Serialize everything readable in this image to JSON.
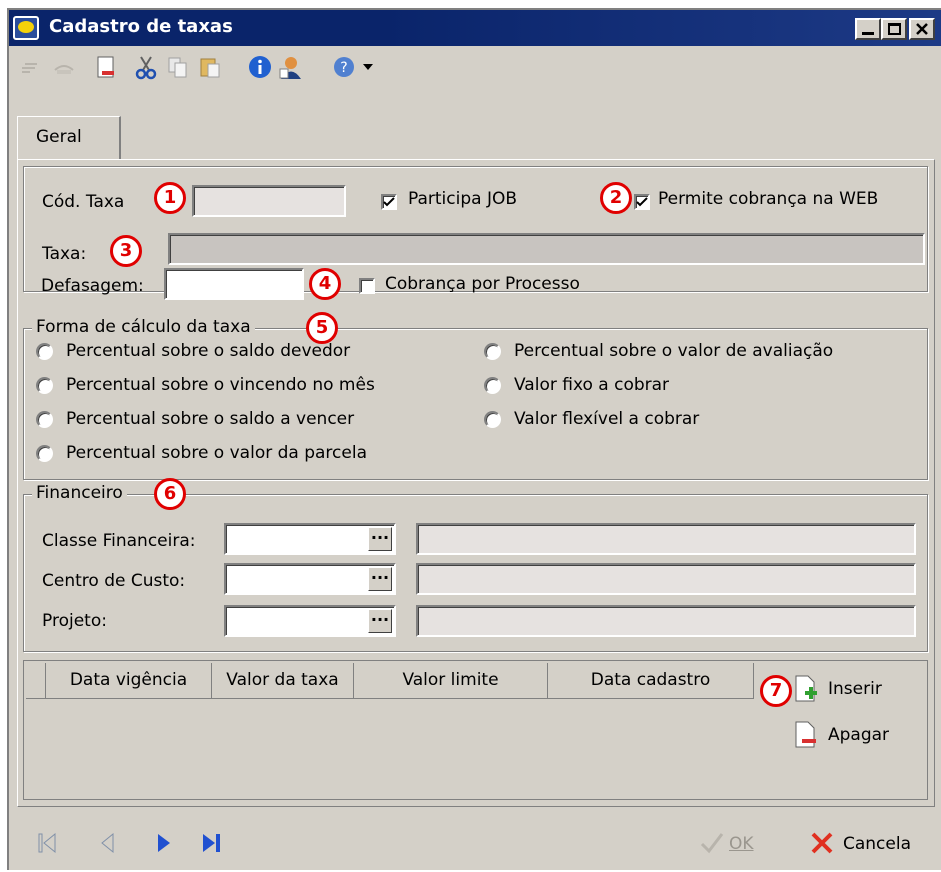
{
  "window": {
    "title": "Cadastro de taxas",
    "minimize_label": "_",
    "maximize_label": "□",
    "close_label": "✕"
  },
  "toolbar": {
    "items": [
      "undo-icon",
      "redo-icon",
      "new-document-icon",
      "cut-icon",
      "copy-icon",
      "paste-icon",
      "info-icon",
      "user-icon",
      "help-icon",
      "dropdown-arrow-icon"
    ]
  },
  "tabs": [
    {
      "label": "Geral"
    }
  ],
  "main": {
    "cod_taxa_label": "Cód. Taxa",
    "cod_taxa_value": "",
    "participa_job_label": "Participa JOB",
    "participa_job_checked": true,
    "permite_cobranca_label": "Permite cobrança na WEB",
    "permite_cobranca_checked": true,
    "taxa_label": "Taxa:",
    "taxa_value": "",
    "defasagem_label": "Defasagem:",
    "defasagem_value": "",
    "cobranca_processo_label": "Cobrança por Processo",
    "cobranca_processo_checked": false
  },
  "forma_calculo": {
    "legend": "Forma de cálculo da taxa",
    "left_options": [
      "Percentual sobre o saldo devedor",
      "Percentual sobre o vincendo no mês",
      "Percentual sobre o saldo a vencer",
      "Percentual sobre o valor da parcela"
    ],
    "right_options": [
      "Percentual sobre o valor de avaliação",
      "Valor fixo a cobrar",
      "Valor flexível a cobrar"
    ]
  },
  "financeiro": {
    "legend": "Financeiro",
    "classe_label": "Classe Financeira:",
    "centro_label": "Centro de Custo:",
    "projeto_label": "Projeto:",
    "ellipsis": "..."
  },
  "grid": {
    "columns": [
      "Data vigência",
      "Valor da taxa",
      "Valor limite",
      "Data cadastro"
    ],
    "rows": [],
    "inserir_label": "Inserir",
    "apagar_label": "Apagar"
  },
  "markers": [
    "1",
    "2",
    "3",
    "4",
    "5",
    "6",
    "7"
  ],
  "footer": {
    "ok_label": "OK",
    "cancel_label": "Cancela"
  },
  "colors": {
    "title_bar": "#0a246a",
    "marker": "#e00000",
    "window_bg": "#d4d0c8"
  }
}
